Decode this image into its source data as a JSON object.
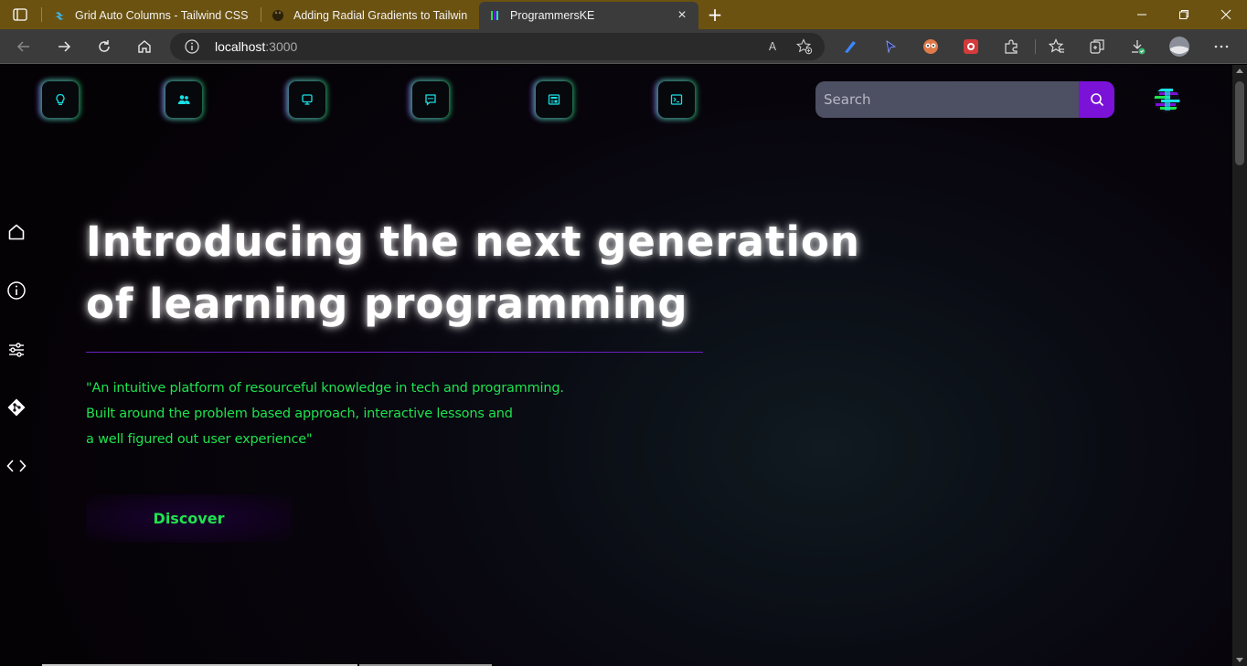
{
  "browser": {
    "tabs": [
      {
        "title": "Grid Auto Columns - Tailwind CSS",
        "favicon": "tailwind-icon",
        "active": false
      },
      {
        "title": "Adding Radial Gradients to Tailwind",
        "favicon": "github-icon",
        "active": false
      },
      {
        "title": "ProgrammersKE",
        "favicon": "programmerske-icon",
        "active": true
      }
    ],
    "close_glyph": "×",
    "new_tab_glyph": "+",
    "address": {
      "host": "localhost",
      "port": ":3000"
    },
    "read_aloud_glyph": "A",
    "accent_color": "#6b5210"
  },
  "nav": {
    "icons": [
      "bulb-icon",
      "users-icon",
      "monitor-icon",
      "chat-icon",
      "newspaper-icon",
      "terminal-icon"
    ],
    "icon_color": "#18e0e6",
    "search_placeholder": "Search",
    "search_button_color": "#7a12d8"
  },
  "sidebar": {
    "icons": [
      "home-icon",
      "info-icon",
      "sliders-icon",
      "git-icon",
      "code-icon"
    ]
  },
  "hero": {
    "title_line1": "Introducing the next generation",
    "title_line2": "of learning programming",
    "desc_line1": "\"An intuitive platform of resourceful knowledge in tech and programming.",
    "desc_line2": "Built around the problem based approach, interactive lessons and",
    "desc_line3": "a well figured out user experience\"",
    "cta_label": "Discover",
    "accent_green": "#1fe34e",
    "divider_color": "#6a1fc2"
  }
}
